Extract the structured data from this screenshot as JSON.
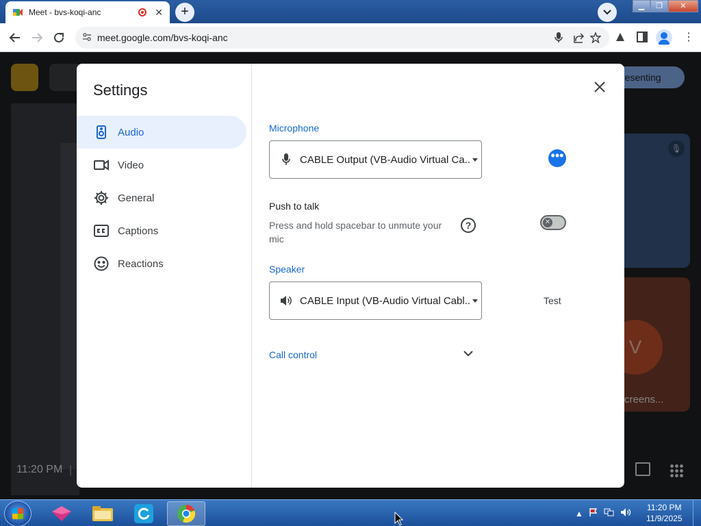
{
  "browser": {
    "tab_title": "Meet - bvs-koqi-anc",
    "tab_close": "✕",
    "new_tab": "+",
    "url": "meet.google.com/bvs-koqi-anc"
  },
  "meet": {
    "presenting_label": "resenting",
    "tile_avatar_letter": "V",
    "tile_name": "creens...",
    "time": "11:20 PM",
    "separator": "|"
  },
  "settings": {
    "title": "Settings",
    "nav": [
      {
        "label": "Audio",
        "icon": "speaker-icon",
        "active": true
      },
      {
        "label": "Video",
        "icon": "video-icon"
      },
      {
        "label": "General",
        "icon": "gear-icon"
      },
      {
        "label": "Captions",
        "icon": "captions-icon"
      },
      {
        "label": "Reactions",
        "icon": "smiley-icon"
      }
    ],
    "microphone": {
      "label": "Microphone",
      "value": "CABLE Output (VB-Audio Virtual Ca..."
    },
    "push_to_talk": {
      "title": "Push to talk",
      "description": "Press and hold spacebar to unmute your mic",
      "help": "?",
      "enabled": false
    },
    "speaker": {
      "label": "Speaker",
      "value": "CABLE Input (VB-Audio Virtual Cabl...",
      "test_label": "Test"
    },
    "call_control": {
      "label": "Call control"
    },
    "more_options": "•••"
  },
  "taskbar": {
    "time": "11:20 PM",
    "date": "11/9/2025"
  },
  "colors": {
    "accent": "#1a73e8",
    "nav_active_bg": "#e8f0fe",
    "section_label": "#1967d2"
  }
}
